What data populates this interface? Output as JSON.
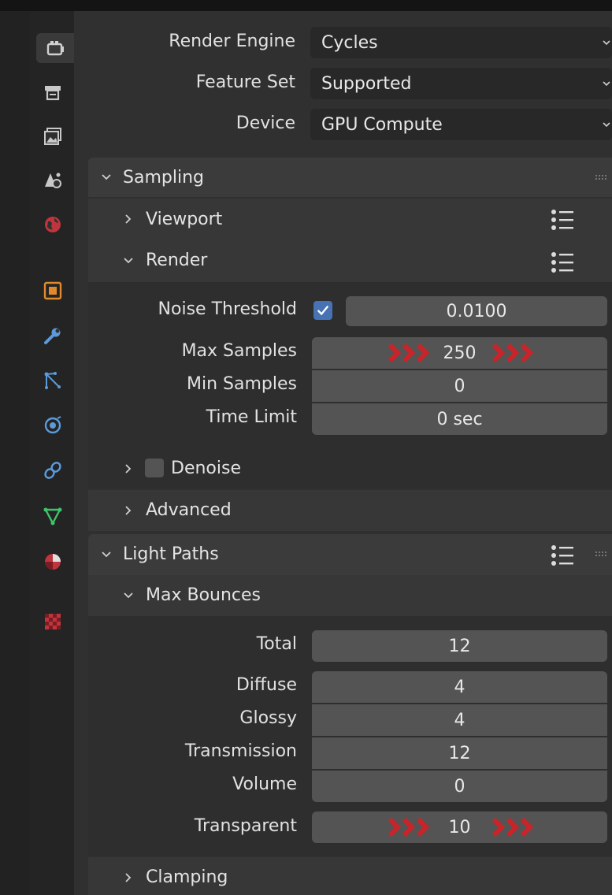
{
  "header_fields": {
    "render_engine": {
      "label": "Render Engine",
      "value": "Cycles"
    },
    "feature_set": {
      "label": "Feature Set",
      "value": "Supported"
    },
    "device": {
      "label": "Device",
      "value": "GPU Compute"
    }
  },
  "sampling": {
    "title": "Sampling",
    "viewport": "Viewport",
    "render": "Render",
    "noise_threshold": {
      "label": "Noise Threshold",
      "value": "0.0100",
      "checked": true
    },
    "max_samples": {
      "label": "Max Samples",
      "value": "250"
    },
    "min_samples": {
      "label": "Min Samples",
      "value": "0"
    },
    "time_limit": {
      "label": "Time Limit",
      "value": "0 sec"
    },
    "denoise": {
      "label": "Denoise",
      "checked": false
    },
    "advanced": "Advanced"
  },
  "light_paths": {
    "title": "Light Paths",
    "max_bounces": "Max Bounces",
    "total": {
      "label": "Total",
      "value": "12"
    },
    "diffuse": {
      "label": "Diffuse",
      "value": "4"
    },
    "glossy": {
      "label": "Glossy",
      "value": "4"
    },
    "transmission": {
      "label": "Transmission",
      "value": "12"
    },
    "volume": {
      "label": "Volume",
      "value": "0"
    },
    "transparent": {
      "label": "Transparent",
      "value": "10"
    },
    "clamping": "Clamping"
  },
  "colors": {
    "accent_checkbox": "#4772b3",
    "annotation_arrows": "#c8242a"
  },
  "tabs": [
    "render-tab-icon",
    "output-tab-icon",
    "view-layer-tab-icon",
    "scene-tab-icon",
    "world-tab-icon",
    "object-tab-icon",
    "modifier-tab-icon",
    "particles-tab-icon",
    "physics-tab-icon",
    "constraints-tab-icon",
    "data-tab-icon",
    "material-tab-icon",
    "texture-tab-icon"
  ]
}
